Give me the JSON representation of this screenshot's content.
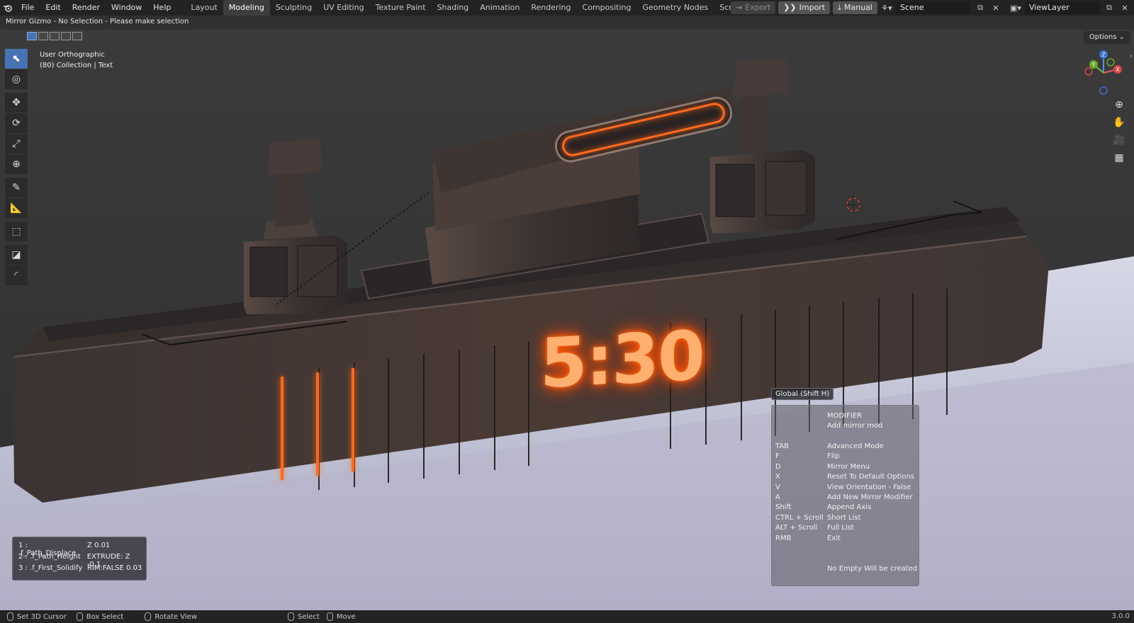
{
  "menu": [
    "File",
    "Edit",
    "Render",
    "Window",
    "Help"
  ],
  "workspaces": [
    "Layout",
    "Modeling",
    "Sculpting",
    "UV Editing",
    "Texture Paint",
    "Shading",
    "Animation",
    "Rendering",
    "Compositing",
    "Geometry Nodes",
    "Scripting"
  ],
  "active_workspace": "Modeling",
  "header_buttons": {
    "export": "Export",
    "import": "Import",
    "manual": "Manual"
  },
  "scene": "Scene",
  "view_layer": "ViewLayer",
  "status_message": "Mirror Gizmo - No Selection - Please make selection",
  "view": {
    "name": "User Orthographic",
    "collection": "(80) Collection | Text"
  },
  "options_label": "Options",
  "model_display_text": "5:30",
  "gizmo_axes": {
    "z": "Z",
    "y": "Y",
    "x": "X"
  },
  "modifier_panel": [
    {
      "index": "1 : .f_Path_Displace",
      "value": "Z 0.01"
    },
    {
      "index": "2 : .f_Path_Height",
      "value": "EXTRUDE: Z -0.1"
    },
    {
      "index": "3 : .f_First_Solidify",
      "value": "RIM:FALSE 0.03"
    }
  ],
  "help": {
    "title": "Global (Shift H)",
    "header": [
      "MODIFIER",
      "Add mirror mod"
    ],
    "rows": [
      {
        "key": "TAB",
        "action": "Advanced Mode"
      },
      {
        "key": "F",
        "action": "Flip"
      },
      {
        "key": "D",
        "action": "Mirror Menu"
      },
      {
        "key": "X",
        "action": "Reset To Default Options"
      },
      {
        "key": "V",
        "action": "View Orientation - False"
      },
      {
        "key": "A",
        "action": "Add New Mirror Modifier"
      },
      {
        "key": "Shift",
        "action": "Append Axis"
      },
      {
        "key": "CTRL + Scroll",
        "action": "Short List"
      },
      {
        "key": "ALT + Scroll",
        "action": "Full List"
      },
      {
        "key": "RMB",
        "action": "Exit"
      }
    ],
    "footer": "No Empty Will be created"
  },
  "statusbar": {
    "left": "Set 3D Cursor",
    "middle1": "Box Select",
    "middle2": "Rotate View",
    "right1": "Select",
    "right2": "Move"
  },
  "version": "3.0.0",
  "colors": {
    "accent": "#4772b3",
    "glow": "#ff6a1a",
    "body": "#4a3f3b"
  }
}
